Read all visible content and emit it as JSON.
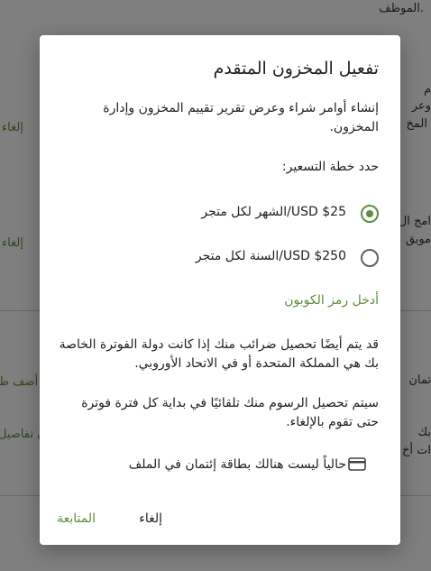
{
  "background": {
    "top_text": "الموظف.",
    "cancel_label_1": "إلغاء",
    "cancel_label_2": "إلغاء",
    "add_label": "أضف ط",
    "details_label": "ن تفاصيل",
    "right_fragment_1": "م",
    "right_fragment_2": "وعر",
    "right_fragment_3": "المخ",
    "right_fragment_4": "امج ال",
    "right_fragment_5": "مويق",
    "right_fragment_6": "تمان",
    "right_fragment_7": "بك",
    "right_fragment_8": "ات أخ"
  },
  "dialog": {
    "title": "تفعيل المخزون المتقدم",
    "description": "إنشاء أوامر شراء وعرض تقرير تقييم المخزون وإدارة المخزون.",
    "plan_label": "حدد خطة التسعير:",
    "plans": [
      {
        "label": "USD $25/الشهر لكل متجر",
        "selected": true
      },
      {
        "label": "USD $250/السنة لكل متجر",
        "selected": false
      }
    ],
    "coupon_link": "أدخل رمز الكوبون",
    "tax_note": "قد يتم أيضًا تحصيل ضرائب منك إذا كانت دولة الفوترة الخاصة بك هي المملكة المتحدة أو في الاتحاد الأوروبي.",
    "fees_note": "سيتم تحصيل الرسوم منك تلقائيًا في بداية كل فترة فوترة حتى تقوم بالإلغاء.",
    "card_status": "حالياً ليست هنالك بطاقة إئتمان في الملف",
    "card_icon": "credit-card-icon",
    "cancel_button": "إلغاء",
    "continue_button": "المتابعة"
  },
  "colors": {
    "accent": "#5e8e3e",
    "overlay": "rgba(0,0,0,0.5)"
  }
}
